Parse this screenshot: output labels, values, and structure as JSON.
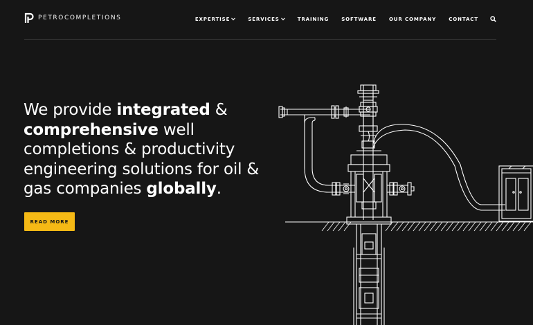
{
  "brand": {
    "name": "PETROCOMPLETIONS"
  },
  "nav": {
    "items": [
      {
        "label": "EXPERTISE",
        "dropdown": true
      },
      {
        "label": "SERVICES",
        "dropdown": true
      },
      {
        "label": "TRAINING",
        "dropdown": false
      },
      {
        "label": "SOFTWARE",
        "dropdown": false
      },
      {
        "label": "OUR COMPANY",
        "dropdown": false
      },
      {
        "label": "CONTACT",
        "dropdown": false
      }
    ],
    "search_icon": "search-icon"
  },
  "hero": {
    "parts": [
      {
        "text": "We provide ",
        "bold": false
      },
      {
        "text": "integrated",
        "bold": true
      },
      {
        "text": " & ",
        "bold": false
      },
      {
        "text": "comprehensive",
        "bold": true
      },
      {
        "text": " well completions & productivity engineering solutions for oil & gas companies ",
        "bold": false
      },
      {
        "text": "globally",
        "bold": true
      },
      {
        "text": ".",
        "bold": false
      }
    ]
  },
  "cta": {
    "label": "READ MORE"
  },
  "colors": {
    "background": "#161616",
    "accent": "#f5b915",
    "text": "#ffffff",
    "divider": "#3a3a3a"
  },
  "icons": {
    "logo": "petrocompletions-logo-icon",
    "caret": "chevron-down-icon",
    "illustration": "wellhead-pipeline-illustration"
  }
}
